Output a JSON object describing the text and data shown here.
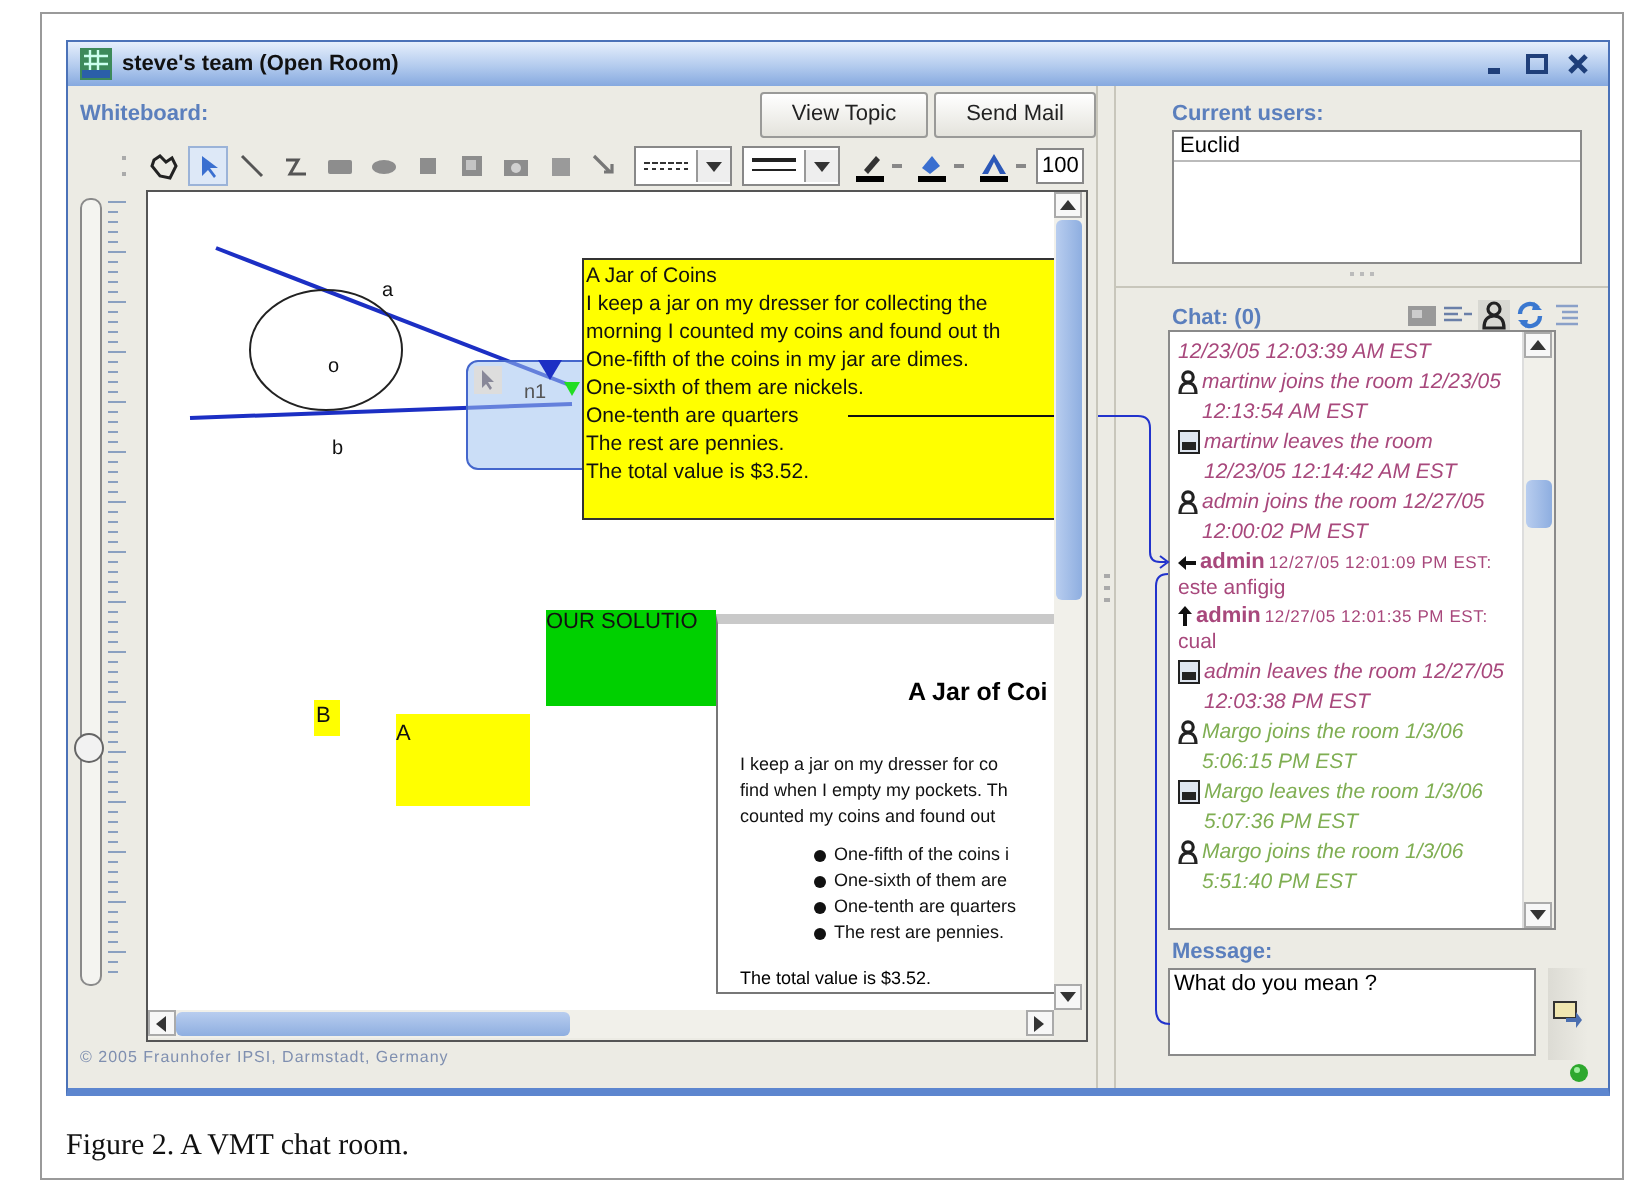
{
  "window": {
    "title": "steve's team (Open Room)"
  },
  "whiteboard": {
    "label": "Whiteboard:",
    "buttons": [
      "View Topic",
      "Send Mail"
    ],
    "tools": [
      {
        "kind": "hand",
        "selected": false
      },
      {
        "kind": "pointer",
        "selected": true
      },
      {
        "kind": "line",
        "selected": false
      },
      {
        "kind": "connector",
        "selected": false
      },
      {
        "kind": "rectangle",
        "selected": false
      },
      {
        "kind": "ellipse",
        "selected": false
      },
      {
        "kind": "square",
        "selected": false
      },
      {
        "kind": "image",
        "selected": false
      },
      {
        "kind": "camera",
        "selected": false
      },
      {
        "kind": "grid",
        "selected": false
      },
      {
        "kind": "arrow",
        "selected": false
      }
    ],
    "zoom": "100",
    "zoom_slider": {
      "level": 0.3
    },
    "canvas": {
      "labels": [
        "a",
        "o",
        "b"
      ],
      "node": "n1",
      "text_box": [
        "A Jar of Coins",
        "I keep a jar on my dresser for collecting the",
        "morning I counted my coins and found out th",
        "One-fifth of the coins in my jar are dimes.",
        "One-sixth of them are nickels.",
        "One-tenth are quarters",
        "The rest are pennies.",
        "The total value is $3.52."
      ],
      "notes": [
        {
          "text": "OUR SOLUTIO",
          "color": "#00d000"
        },
        {
          "text": "B",
          "color": "#ffff00"
        },
        {
          "text": "A",
          "color": "#ffff00"
        }
      ],
      "topic": {
        "title": "A Jar of Coi",
        "paragraph": [
          "I keep a jar on my dresser for co",
          "find when I empty my pockets. Th",
          "counted my coins and found out"
        ],
        "bullets": [
          "One-fifth of the coins i",
          "One-sixth of them are",
          "One-tenth are quarters",
          "The rest are pennies."
        ],
        "total": "The total value is $3.52."
      }
    },
    "footer": "© 2005 Fraunhofer IPSI, Darmstadt, Germany"
  },
  "users": {
    "label": "Current users:",
    "items": [
      "Euclid"
    ]
  },
  "chat": {
    "label": "Chat: (0)",
    "messages": [
      {
        "kind": "note",
        "text": "12/23/05 12:03:39 AM EST",
        "color": "#a8487c"
      },
      {
        "kind": "join",
        "text": "martinw joins the room 12/23/05 12:13:54 AM EST",
        "color": "#a8487c"
      },
      {
        "kind": "leave",
        "text": "martinw leaves the room 12/23/05 12:14:42 AM EST",
        "color": "#a8487c"
      },
      {
        "kind": "join",
        "text": "admin joins the room 12/27/05 12:00:02 PM EST",
        "color": "#a8487c"
      },
      {
        "kind": "message",
        "user": "admin",
        "time": "12/27/05 12:01:09 PM EST:",
        "text": "este anfigig",
        "color": "#a8487c"
      },
      {
        "kind": "reply",
        "user": "admin",
        "time": "12/27/05 12:01:35 PM EST:",
        "text": "cual",
        "color": "#a8487c"
      },
      {
        "kind": "leave",
        "text": "admin leaves the room 12/27/05 12:03:38 PM EST",
        "color": "#a8487c"
      },
      {
        "kind": "join",
        "text": "Margo joins the room 1/3/06 5:06:15 PM EST",
        "color": "#7fae52"
      },
      {
        "kind": "leave",
        "text": "Margo leaves the room 1/3/06 5:07:36 PM EST",
        "color": "#7fae52"
      },
      {
        "kind": "join",
        "text": "Margo joins the room 1/3/06 5:51:40 PM EST",
        "color": "#7fae52"
      }
    ]
  },
  "message": {
    "label": "Message:",
    "value": "What do you mean ?"
  },
  "caption": "Figure 2. A VMT chat room."
}
